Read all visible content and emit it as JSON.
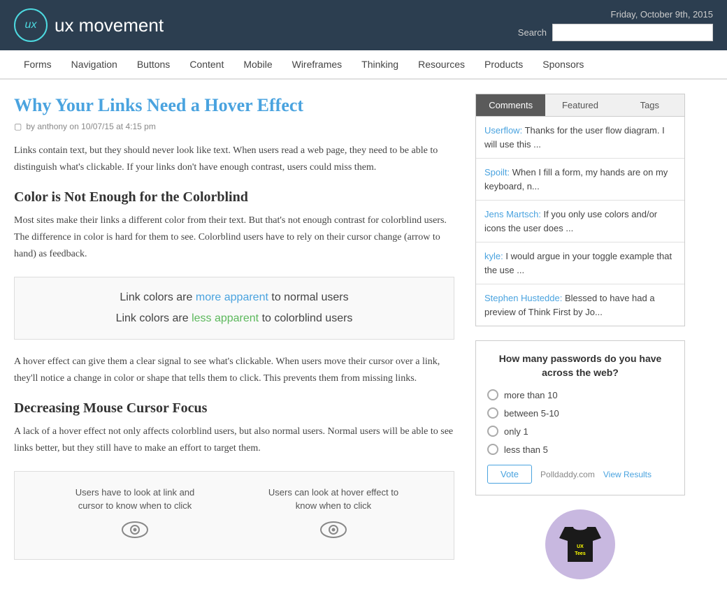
{
  "header": {
    "logo_text": "ux movement",
    "logo_ux": "ux",
    "date": "Friday, October 9th, 2015",
    "search_label": "Search",
    "search_placeholder": ""
  },
  "nav": {
    "items": [
      "Forms",
      "Navigation",
      "Buttons",
      "Content",
      "Mobile",
      "Wireframes",
      "Thinking",
      "Resources",
      "Products",
      "Sponsors"
    ]
  },
  "article": {
    "title": "Why Your Links Need a Hover Effect",
    "meta": "by anthony on 10/07/15 at 4:15 pm",
    "intro": "Links contain text, but they should never look like text. When users read a web page, they need to be able to distinguish what's clickable. If your links don't have enough contrast, users could miss them.",
    "section1_title": "Color is Not Enough for the Colorblind",
    "section1_body": "Most sites make their links a different color from their text. But that's not enough contrast for colorblind users. The difference in color is hard for them to see. Colorblind users have to rely on their cursor change (arrow to hand) as feedback.",
    "link_demo": {
      "line1_prefix": "Link colors are ",
      "line1_link": "more apparent",
      "line1_suffix": " to normal users",
      "line2_prefix": "Link colors are ",
      "line2_link": "less apparent",
      "line2_suffix": " to colorblind users"
    },
    "section1_body2": "A hover effect can give them a clear signal to see what's clickable. When users move their cursor over a link, they'll notice a change in color or shape that tells them to click. This prevents them from missing links.",
    "section2_title": "Decreasing Mouse Cursor Focus",
    "section2_body": "A lack of a hover effect not only affects colorblind users, but also normal users. Normal users will be able to see links better, but they still have to make an effort to target them.",
    "hover_demo": {
      "col1_text": "Users have to look at link and cursor to know when to click",
      "col2_text": "Users can look at hover effect to know when to click"
    }
  },
  "sidebar": {
    "tabs": [
      "Comments",
      "Featured",
      "Tags"
    ],
    "active_tab": "Comments",
    "comments": [
      {
        "author": "Userflow",
        "text": "Thanks for the user flow diagram. I will use this ..."
      },
      {
        "author": "Spoilt",
        "text": "When I fill a form, my hands are on my keyboard, n..."
      },
      {
        "author": "Jens Martsch",
        "text": "If you only use colors and/or icons the user does ..."
      },
      {
        "author": "kyle",
        "text": "I would argue in your toggle example that the use ..."
      },
      {
        "author": "Stephen Hustedde",
        "text": "Blessed to have had a preview of Think First by Jo..."
      }
    ],
    "poll": {
      "question": "How many passwords do you have across the web?",
      "options": [
        "more than 10",
        "between 5-10",
        "only 1",
        "less than 5"
      ],
      "vote_label": "Vote",
      "polldaddy": "Polldaddy.com",
      "view_results": "View Results"
    },
    "ux_tees": {
      "label1": "UX",
      "label2": "Tees"
    }
  }
}
